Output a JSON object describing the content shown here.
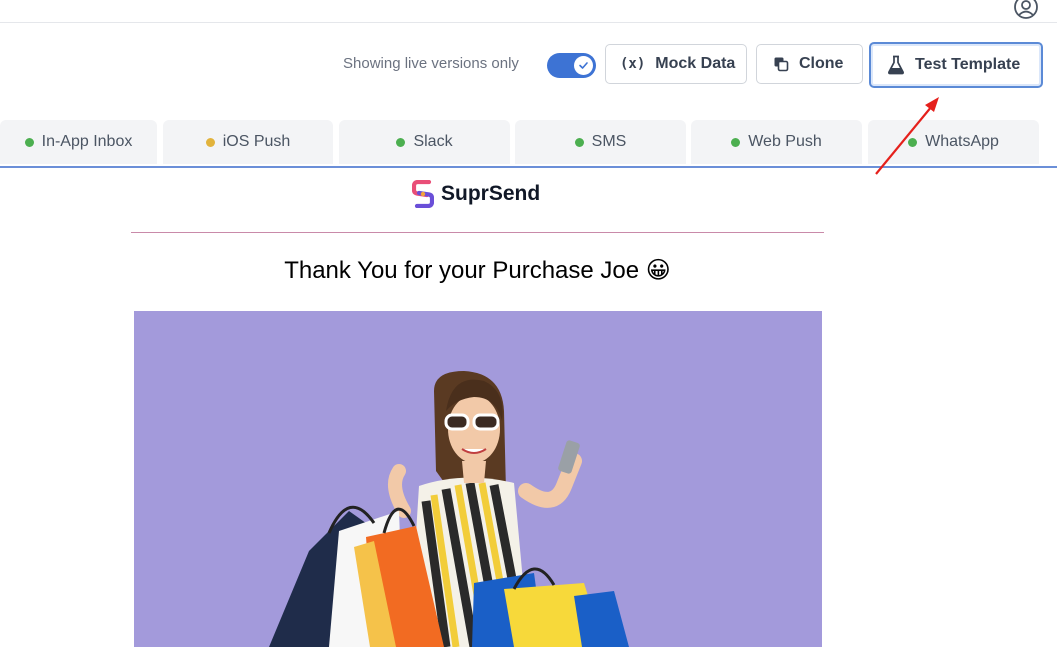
{
  "toolbar": {
    "live_label": "Showing live versions only",
    "live_toggle_on": true,
    "mock_icon": "(x)",
    "mock_label": "Mock Data",
    "clone_label": "Clone",
    "test_label": "Test Template"
  },
  "tabs": [
    {
      "label": "In-App Inbox",
      "status_color": "#4caf50"
    },
    {
      "label": "iOS Push",
      "status_color": "#e2b33c"
    },
    {
      "label": "Slack",
      "status_color": "#4caf50"
    },
    {
      "label": "SMS",
      "status_color": "#4caf50"
    },
    {
      "label": "Web Push",
      "status_color": "#4caf50"
    },
    {
      "label": "WhatsApp",
      "status_color": "#4caf50"
    }
  ],
  "preview": {
    "brand_name": "SuprSend",
    "heading": "Thank You for your Purchase Joe 😀",
    "hero_background": "#a39adb"
  },
  "annotation": {
    "arrow_color": "#e5201c"
  },
  "colors": {
    "accent": "#3d73d4",
    "tab_underline": "#6b8fd8"
  }
}
